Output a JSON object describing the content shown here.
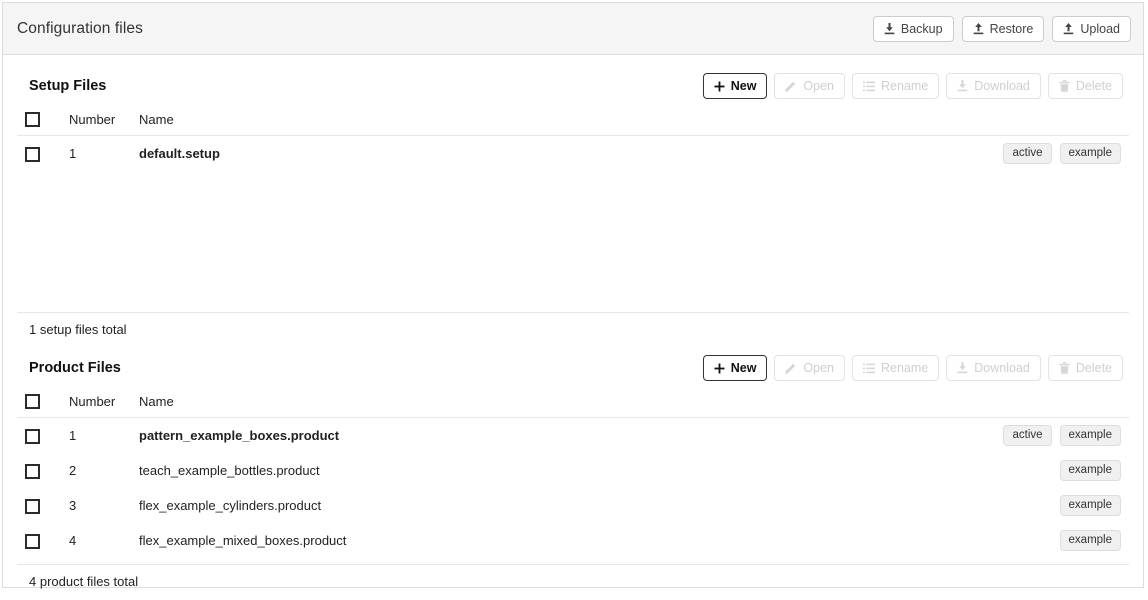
{
  "header": {
    "title": "Configuration files",
    "actions": [
      {
        "label": "Backup",
        "icon": "download-icon",
        "state": "enabled"
      },
      {
        "label": "Restore",
        "icon": "upload-icon",
        "state": "enabled"
      },
      {
        "label": "Upload",
        "icon": "upload-icon",
        "state": "enabled"
      }
    ]
  },
  "toolbar": {
    "new_label": "New",
    "open_label": "Open",
    "rename_label": "Rename",
    "download_label": "Download",
    "delete_label": "Delete"
  },
  "columns": {
    "number": "Number",
    "name": "Name"
  },
  "setup_section": {
    "title": "Setup Files",
    "footer": "1 setup files total",
    "rows": [
      {
        "number": "1",
        "name": "default.setup",
        "active": true,
        "tags": [
          "active",
          "example"
        ]
      }
    ]
  },
  "product_section": {
    "title": "Product Files",
    "footer": "4 product files total",
    "rows": [
      {
        "number": "1",
        "name": "pattern_example_boxes.product",
        "active": true,
        "tags": [
          "active",
          "example"
        ]
      },
      {
        "number": "2",
        "name": "teach_example_bottles.product",
        "active": false,
        "tags": [
          "example"
        ]
      },
      {
        "number": "3",
        "name": "flex_example_cylinders.product",
        "active": false,
        "tags": [
          "example"
        ]
      },
      {
        "number": "4",
        "name": "flex_example_mixed_boxes.product",
        "active": false,
        "tags": [
          "example"
        ]
      }
    ]
  },
  "colors": {
    "header_bg": "#f5f5f5",
    "border": "#dcdcdc",
    "tag_bg": "#f0f0f0",
    "disabled_text": "#cfcfcf"
  }
}
